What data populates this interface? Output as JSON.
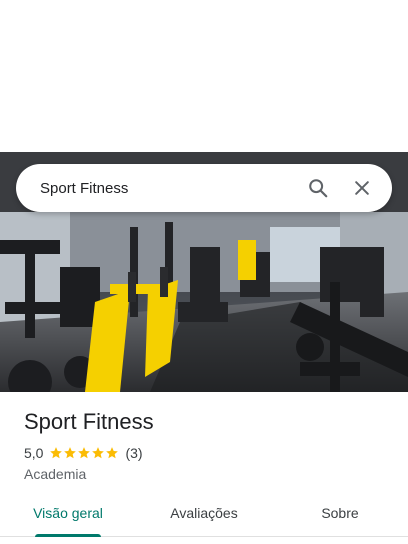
{
  "search": {
    "query": "Sport Fitness",
    "search_icon": "search-icon",
    "close_icon": "close-icon"
  },
  "hero_photo": {
    "subject": "gym-interior-photo"
  },
  "place": {
    "title": "Sport Fitness",
    "rating": "5,0",
    "stars": 5,
    "review_count": "(3)",
    "category": "Academia"
  },
  "tabs": [
    {
      "label": "Visão geral",
      "active": true
    },
    {
      "label": "Avaliações",
      "active": false
    },
    {
      "label": "Sobre",
      "active": false
    }
  ],
  "colors": {
    "accent": "#00796b",
    "star": "#fbbc04",
    "machine_yellow": "#f5d000"
  }
}
